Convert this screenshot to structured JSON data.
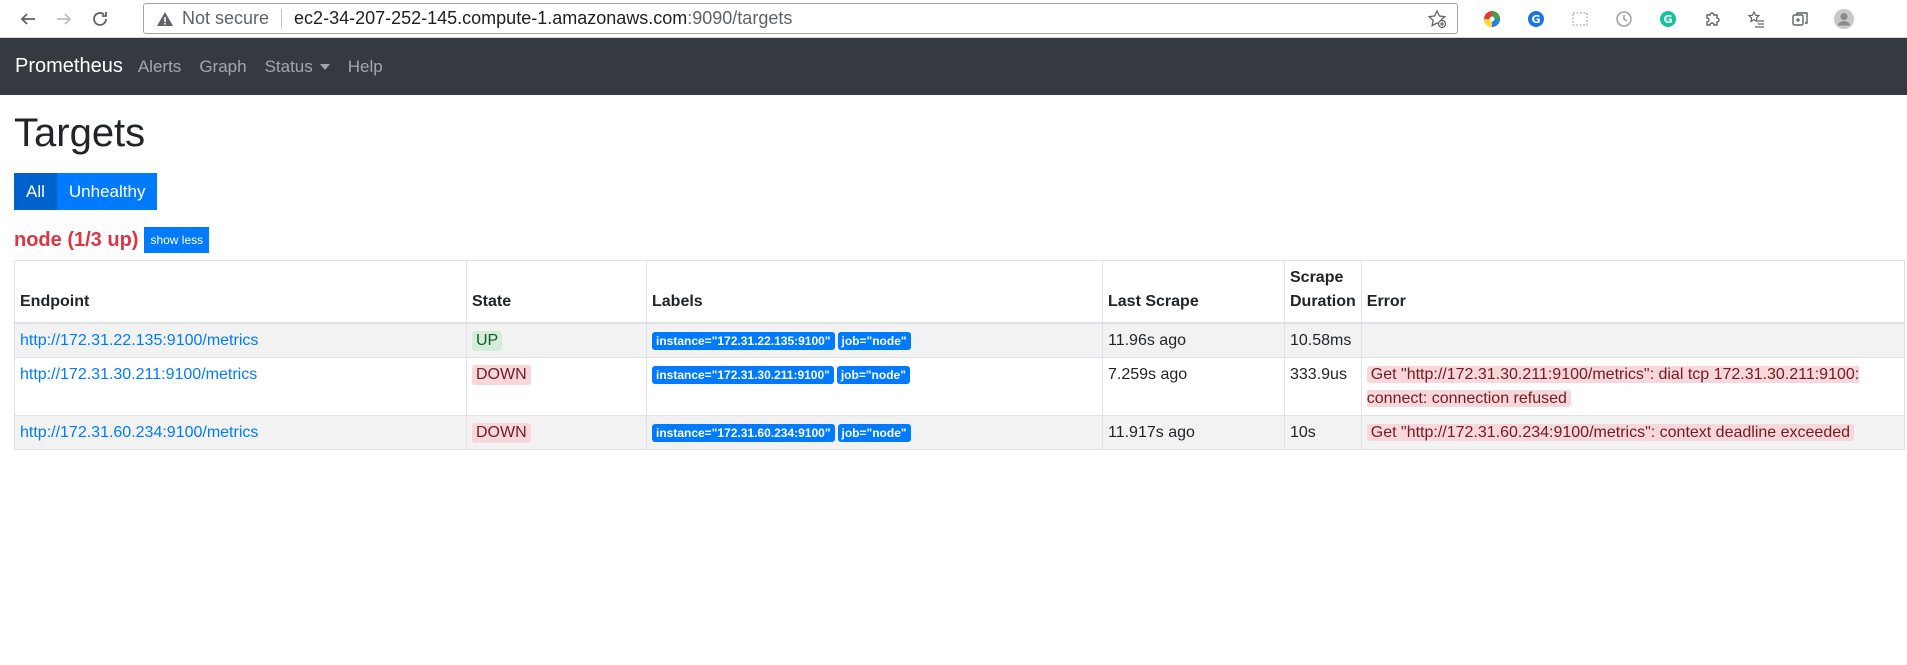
{
  "browser": {
    "not_secure": "Not secure",
    "url_host": "ec2-34-207-252-145.compute-1.amazonaws.com",
    "url_path": ":9090/targets"
  },
  "navbar": {
    "brand": "Prometheus",
    "links": [
      "Alerts",
      "Graph",
      "Status",
      "Help"
    ]
  },
  "page": {
    "title": "Targets",
    "filters": [
      "All",
      "Unhealthy"
    ],
    "job": {
      "title": "node (1/3 up)",
      "toggle_label": "show less"
    }
  },
  "table": {
    "headers": [
      "Endpoint",
      "State",
      "Labels",
      "Last Scrape",
      "Scrape Duration",
      "Error"
    ],
    "rows": [
      {
        "endpoint": "http://172.31.22.135:9100/metrics",
        "state": "UP",
        "labels": [
          "instance=\"172.31.22.135:9100\"",
          "job=\"node\""
        ],
        "last_scrape": "11.96s ago",
        "duration": "10.58ms",
        "error": ""
      },
      {
        "endpoint": "http://172.31.30.211:9100/metrics",
        "state": "DOWN",
        "labels": [
          "instance=\"172.31.30.211:9100\"",
          "job=\"node\""
        ],
        "last_scrape": "7.259s ago",
        "duration": "333.9us",
        "error": "Get \"http://172.31.30.211:9100/metrics\": dial tcp 172.31.30.211:9100: connect: connection refused"
      },
      {
        "endpoint": "http://172.31.60.234:9100/metrics",
        "state": "DOWN",
        "labels": [
          "instance=\"172.31.60.234:9100\"",
          "job=\"node\""
        ],
        "last_scrape": "11.917s ago",
        "duration": "10s",
        "error": "Get \"http://172.31.60.234:9100/metrics\": context deadline exceeded"
      }
    ]
  },
  "colors": {
    "navbar_bg": "#343a40",
    "primary": "#007bff",
    "danger": "#dc3545"
  }
}
